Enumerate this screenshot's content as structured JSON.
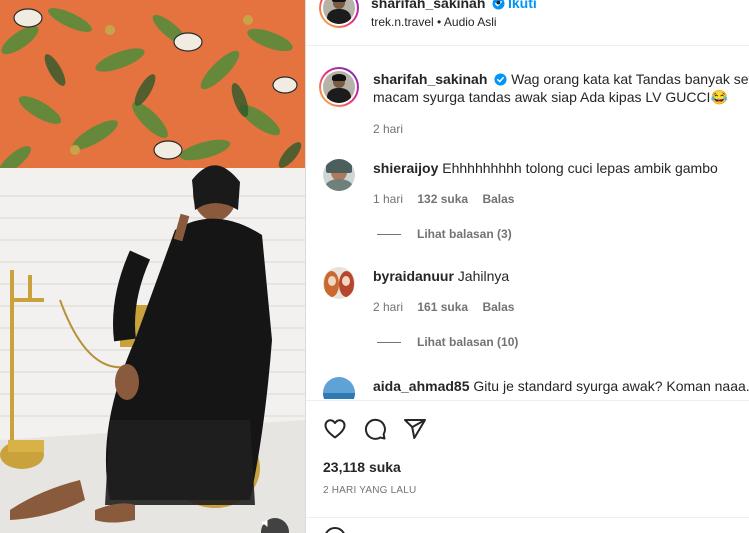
{
  "post": {
    "author": "sharifah_sakinah",
    "follow_label": "Ikuti",
    "dot": "•",
    "subtitle": "trek.n.travel • Audio Asli",
    "verified_icon": "verified-badge-icon",
    "accent_color": "#0095f6"
  },
  "caption": {
    "username": "sharifah_sakinah",
    "text": "Wag orang kata kat Tandas banyak setans",
    "text_line2": "macam syurga tandas awak siap Ada kipas LV GUCCI😂",
    "time": "2 hari"
  },
  "comments": [
    {
      "username": "shieraijoy",
      "text": "Ehhhhhhhhh tolong cuci lepas ambik gambo",
      "time": "1 hari",
      "likes": "132 suka",
      "reply_label": "Balas",
      "view_replies": "Lihat balasan (3)"
    },
    {
      "username": "byraidanuur",
      "text": "Jahilnya",
      "time": "2 hari",
      "likes": "161 suka",
      "reply_label": "Balas",
      "view_replies": "Lihat balasan (10)"
    },
    {
      "username": "aida_ahmad85",
      "text": "Gitu je standard syurga awak? Koman naaa.."
    }
  ],
  "actions": {
    "like_icon": "heart-icon",
    "comment_icon": "comment-icon",
    "share_icon": "share-icon",
    "likes": "23,118 suka",
    "date": "2 HARI YANG LALU"
  },
  "media": {
    "sound_icon": "speaker-icon"
  }
}
